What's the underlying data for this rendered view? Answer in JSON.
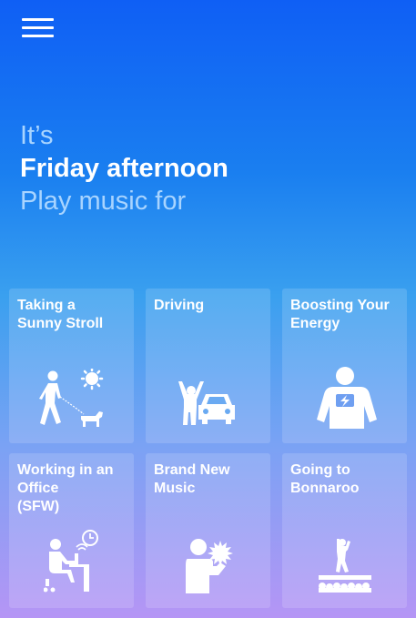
{
  "header": {
    "menu_icon": "hamburger-menu-icon"
  },
  "greeting": {
    "line1": "It’s",
    "line2": "Friday afternoon",
    "line3": "Play music for"
  },
  "activities": [
    {
      "label": "Taking a\nSunny Stroll",
      "icon": "walking-dog-sun-icon"
    },
    {
      "label": "Driving",
      "icon": "car-person-icon"
    },
    {
      "label": "Boosting Your\nEnergy",
      "icon": "energy-person-icon"
    },
    {
      "label": "Working in an\nOffice\n (SFW)",
      "icon": "office-worker-icon"
    },
    {
      "label": "Brand New\nMusic",
      "icon": "new-music-person-icon"
    },
    {
      "label": "Going to\nBonnaroo",
      "icon": "concert-stage-icon"
    }
  ],
  "colors": {
    "gradient_top": "#0f5ff5",
    "gradient_bottom": "#b595f5",
    "greeting_accent": "#a8d4ff",
    "card_bg": "rgba(255,255,255,0.15)"
  }
}
